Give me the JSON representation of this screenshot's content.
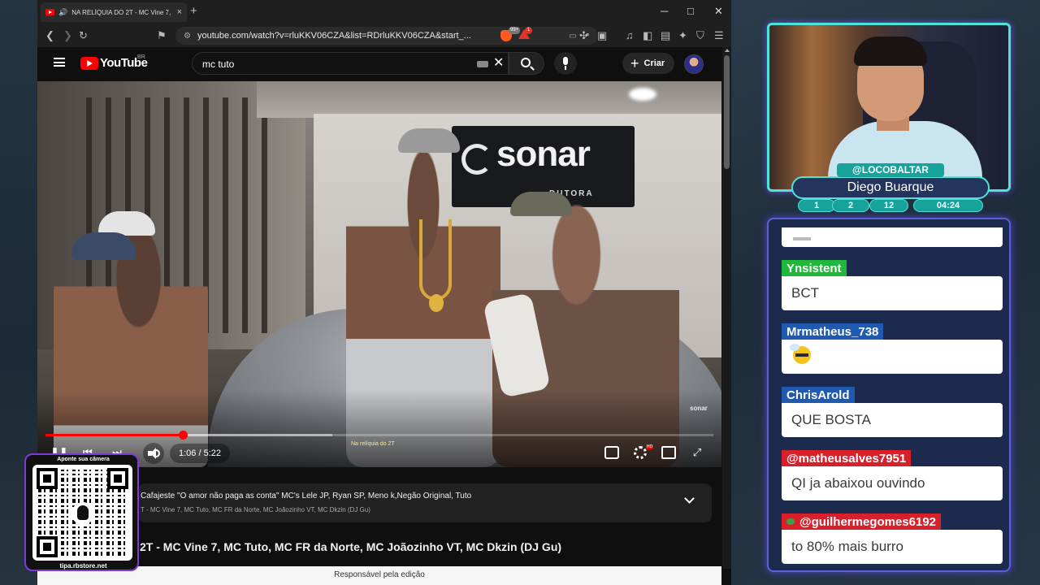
{
  "colors": {
    "yt_red": "#ff0000",
    "chat_green": "#1fb83a",
    "chat_blue": "#1f59b0",
    "chat_red": "#d8202b",
    "overlay_teal": "#17a39b",
    "overlay_cyan": "#4ee3d7"
  },
  "browser": {
    "tab_title": "NA RELÍQUIA DO 2T - MC Vine 7, N",
    "tab_close_icon": "×",
    "new_tab_icon": "+",
    "url": "youtube.com/watch?v=rluKKV06CZA&list=RDrluKKV06CZA&start_...",
    "brave_badge": "99+",
    "alert_badge": "1",
    "window_min": "─",
    "window_max": "□",
    "window_close": "✕"
  },
  "youtube": {
    "logo_text": "YouTube",
    "region": "BR",
    "search_query": "mc tuto",
    "create_label": "Criar"
  },
  "video": {
    "sign_text": "sonar",
    "sign_subtext": "DUTORA",
    "watermark": "sonar",
    "caption": "Na relíquia do 2T",
    "time_display": "1:06 / 5:22",
    "played_fraction": 0.206,
    "buffered_fraction": 0.43,
    "hd_badge": "HD"
  },
  "playlist": {
    "title": "Cafajeste \"O amor não paga as conta\" MC's Lele JP, Ryan SP, Meno k,Negão Original, Tuto",
    "subtitle": "T - MC Vine 7, MC Tuto, MC FR da Norte, MC Joãozinho VT, MC Dkzin (DJ Gu)"
  },
  "main_title": "2T - MC Vine 7, MC Tuto, MC FR da Norte, MC Joãozinho VT, MC Dkzin (DJ Gu)",
  "footer_notice": "Responsável pela edição",
  "qr_overlay": {
    "top_text": "Aponte sua câmera",
    "bottom_text": "tipa.rbstore.net"
  },
  "streamer": {
    "handle": "@LOCOBALTAR",
    "name": "Diego Buarque",
    "stats": [
      "1",
      "2",
      "12",
      "04:24"
    ]
  },
  "chat": {
    "messages": [
      {
        "user": "Ynsistent",
        "text": "BCT",
        "color": "#1fb83a"
      },
      {
        "user": "Mrmatheus_738",
        "text": "",
        "emoji": "bee-emoji",
        "color": "#1f59b0"
      },
      {
        "user": "ChrisArold",
        "text": "QUE BOSTA",
        "color": "#1f59b0"
      },
      {
        "user": "@matheusalves7951",
        "text": "QI ja abaixou ouvindo",
        "color": "#d8202b"
      },
      {
        "user": "@guilhermegomes6192",
        "text": "to 80% mais burro",
        "color": "#d8202b",
        "badge": "green-badge"
      }
    ]
  }
}
